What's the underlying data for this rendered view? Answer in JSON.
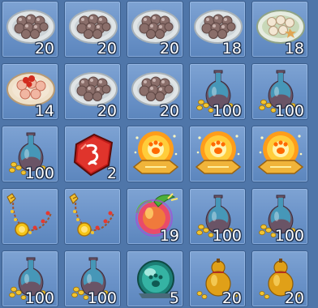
{
  "inventory": {
    "slots": [
      {
        "item": "chestnut-plate",
        "icon": "chestnut-plate-icon",
        "qty": "20"
      },
      {
        "item": "chestnut-plate",
        "icon": "chestnut-plate-icon",
        "qty": "20"
      },
      {
        "item": "chestnut-plate",
        "icon": "chestnut-plate-icon",
        "qty": "20"
      },
      {
        "item": "chestnut-plate",
        "icon": "chestnut-plate-icon",
        "qty": "18"
      },
      {
        "item": "egg-plate",
        "icon": "egg-plate-icon",
        "qty": "18"
      },
      {
        "item": "red-dumpling-plate",
        "icon": "red-dumpling-plate-icon",
        "qty": "14"
      },
      {
        "item": "chestnut-plate",
        "icon": "chestnut-plate-icon",
        "qty": "20"
      },
      {
        "item": "chestnut-plate",
        "icon": "chestnut-plate-icon",
        "qty": "20"
      },
      {
        "item": "coin-vase",
        "icon": "vase-icon",
        "qty": "100"
      },
      {
        "item": "coin-vase",
        "icon": "vase-icon",
        "qty": "100"
      },
      {
        "item": "coin-vase",
        "icon": "vase-icon",
        "qty": "100"
      },
      {
        "item": "red-rune-stone",
        "icon": "rune-stone-icon",
        "qty": "2"
      },
      {
        "item": "paw-orb",
        "icon": "paw-orb-icon",
        "qty": ""
      },
      {
        "item": "paw-orb",
        "icon": "paw-orb-icon",
        "qty": ""
      },
      {
        "item": "paw-orb",
        "icon": "paw-orb-icon",
        "qty": ""
      },
      {
        "item": "gold-necklace",
        "icon": "necklace-icon",
        "qty": ""
      },
      {
        "item": "gold-necklace",
        "icon": "necklace-icon",
        "qty": ""
      },
      {
        "item": "magic-fruit",
        "icon": "magic-fruit-icon",
        "qty": "19"
      },
      {
        "item": "coin-vase",
        "icon": "vase-icon",
        "qty": "100"
      },
      {
        "item": "coin-vase",
        "icon": "vase-icon",
        "qty": "100"
      },
      {
        "item": "coin-vase",
        "icon": "vase-icon",
        "qty": "100"
      },
      {
        "item": "coin-vase",
        "icon": "vase-icon",
        "qty": "100"
      },
      {
        "item": "jade-orb",
        "icon": "jade-orb-icon",
        "qty": "5"
      },
      {
        "item": "gourd",
        "icon": "gourd-icon",
        "qty": "20"
      },
      {
        "item": "gourd",
        "icon": "gourd-icon",
        "qty": "20"
      }
    ]
  },
  "colors": {
    "panel": "#4f76a9",
    "slot": "#6a92c8",
    "qty_text": "#ffffff"
  }
}
